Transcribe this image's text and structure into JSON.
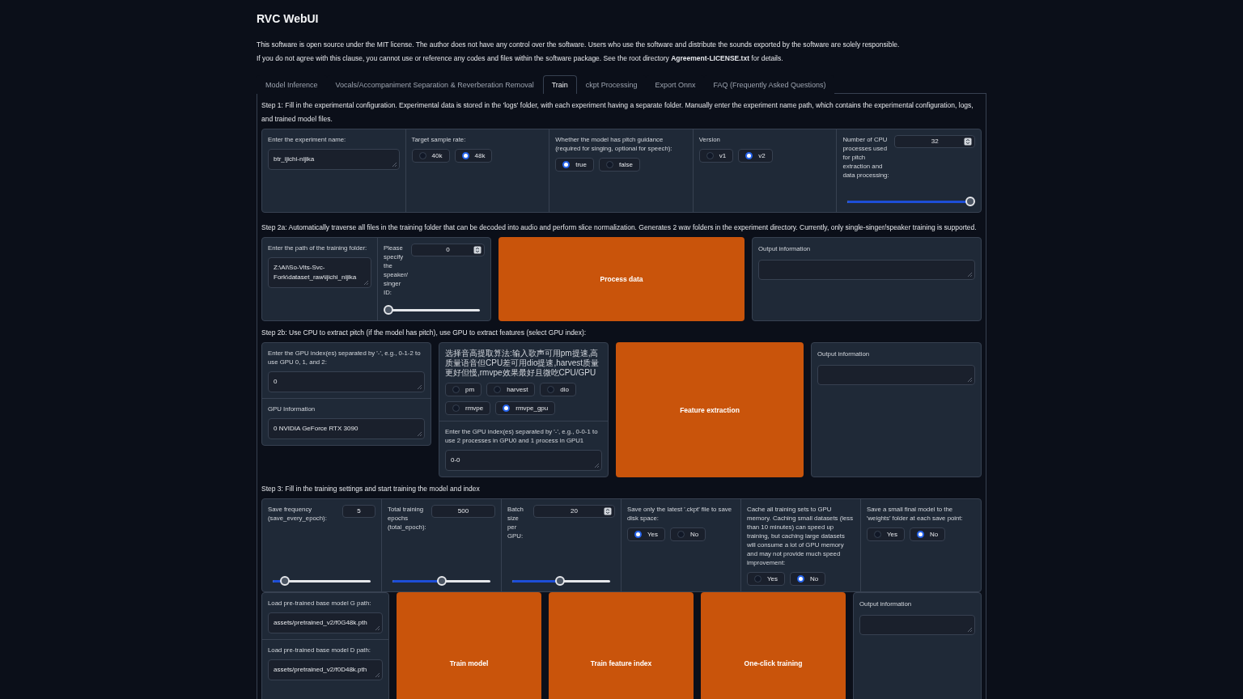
{
  "app_title": "RVC WebUI",
  "notice": [
    "This software is open source under the MIT license. The author does not have any control over the software. Users who use the software and distribute the sounds exported by the software are solely responsible.",
    "If you do not agree with this clause, you cannot use or reference any codes and files within the software package. See the root directory **Agreement-LICENSE.txt** for details."
  ],
  "tabs": [
    {
      "label": "Model Inference",
      "selected": false
    },
    {
      "label": "Vocals/Accompaniment Separation & Reverberation Removal",
      "selected": false
    },
    {
      "label": "Train",
      "selected": true
    },
    {
      "label": "ckpt Processing",
      "selected": false
    },
    {
      "label": "Export Onnx",
      "selected": false
    },
    {
      "label": "FAQ (Frequently Asked Questions)",
      "selected": false
    }
  ],
  "step1": {
    "heading": "Step 1: Fill in the experimental configuration. Experimental data is stored in the 'logs' folder, with each experiment having a separate folder. Manually enter the experiment name path, which contains the experimental configuration, logs, and trained model files.",
    "experiment_name": {
      "label": "Enter the experiment name:",
      "value": "btr_ijichi-nijika"
    },
    "sample_rate": {
      "label": "Target sample rate:",
      "options": [
        {
          "label": "40k",
          "selected": false
        },
        {
          "label": "48k",
          "selected": true
        }
      ]
    },
    "pitch_guidance": {
      "label": "Whether the model has pitch guidance (required for singing, optional for speech):",
      "options": [
        {
          "label": "true",
          "selected": true
        },
        {
          "label": "false",
          "selected": false
        }
      ]
    },
    "version": {
      "label": "Version",
      "options": [
        {
          "label": "v1",
          "selected": false
        },
        {
          "label": "v2",
          "selected": true
        }
      ]
    },
    "cpu_processes": {
      "label": "Number of CPU processes used for pitch extraction and data processing:",
      "value": "32",
      "spinner": true,
      "level": 1
    }
  },
  "step2a": {
    "heading": "Step 2a: Automatically traverse all files in the training folder that can be decoded into audio and perform slice normalization. Generates 2 wav folders in the experiment directory. Currently, only single-singer/speaker training is supported.",
    "folder": {
      "label": "Enter the path of the training folder:",
      "value": "Z:\\AI\\So-Vits-Svc-Fork\\dataset_raw\\ijichi_nijika"
    },
    "speaker": {
      "label": "Please specify the speaker/ singer ID:",
      "value": "0",
      "spinner": true,
      "level": 0
    },
    "button": "Process data",
    "output": {
      "label": "Output information"
    }
  },
  "step2b": {
    "heading": "Step 2b: Use CPU to extract pitch (if the model has pitch), use GPU to extract features (select GPU index):",
    "gpus": {
      "label": "Enter the GPU index(es) separated by '-', e.g., 0-1-2 to use GPU 0, 1, and 2:",
      "value": "0"
    },
    "gpu_info": {
      "label": "GPU Information",
      "value": "0  NVIDIA GeForce RTX 3090"
    },
    "method": {
      "label": "选择音高提取算法:输入歌声可用pm提速,高质量语音但CPU差可用dio提速,harvest质量更好但慢,rmvpe效果最好且微吃CPU/GPU",
      "options": [
        {
          "label": "pm",
          "selected": false
        },
        {
          "label": "harvest",
          "selected": false
        },
        {
          "label": "dio",
          "selected": false
        },
        {
          "label": "rmvpe",
          "selected": false
        },
        {
          "label": "rmvpe_gpu",
          "selected": true
        }
      ]
    },
    "gpus_rmvpe": {
      "label": "Enter the GPU index(es) separated by '-', e.g., 0-0-1 to use 2 processes in GPU0 and 1 process in GPU1",
      "value": "0-0"
    },
    "button": "Feature extraction",
    "output": {
      "label": "Output information"
    }
  },
  "step3": {
    "heading": "Step 3: Fill in the training settings and start training the model and index",
    "sliders": [
      {
        "label": "Save frequency (save_every_epoch):",
        "value": "5",
        "spinner": false,
        "level": 0.12
      },
      {
        "label": "Total training epochs (total_epoch):",
        "value": "500",
        "spinner": false,
        "level": 0.5
      },
      {
        "label": "Batch size per GPU:",
        "value": "20",
        "spinner": true,
        "level": 0.49
      }
    ],
    "choices": [
      {
        "label": "Save only the latest '.ckpt' file to save disk space:",
        "options": [
          {
            "label": "Yes",
            "selected": true
          },
          {
            "label": "No",
            "selected": false
          }
        ]
      },
      {
        "label": "Cache all training sets to GPU memory. Caching small datasets (less than 10 minutes) can speed up training, but caching large datasets will consume a lot of GPU memory and may not provide much speed improvement:",
        "options": [
          {
            "label": "Yes",
            "selected": false
          },
          {
            "label": "No",
            "selected": true
          }
        ]
      },
      {
        "label": "Save a small final model to the 'weights' folder at each save point:",
        "options": [
          {
            "label": "Yes",
            "selected": false
          },
          {
            "label": "No",
            "selected": true
          }
        ]
      }
    ],
    "paths": [
      {
        "label": "Load pre-trained base model G path:",
        "value": "assets/pretrained_v2/f0G48k.pth"
      },
      {
        "label": "Load pre-trained base model D path:",
        "value": "assets/pretrained_v2/f0D48k.pth"
      }
    ],
    "buttons": [
      "Train model",
      "Train feature index",
      "One-click training"
    ],
    "output": {
      "label": "Output information"
    }
  }
}
